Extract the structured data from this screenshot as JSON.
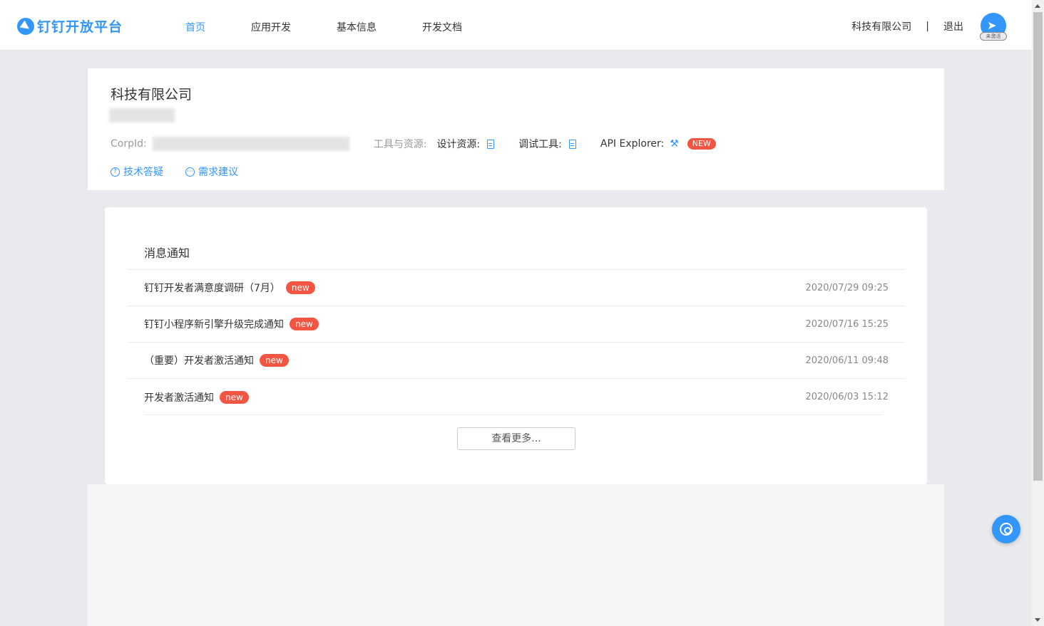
{
  "header": {
    "logo_text": "钉钉开放平台",
    "nav": [
      {
        "label": "首页",
        "active": true
      },
      {
        "label": "应用开发",
        "active": false
      },
      {
        "label": "基本信息",
        "active": false
      },
      {
        "label": "开发文档",
        "active": false
      }
    ],
    "company": "科技有限公司",
    "separator": "|",
    "logout": "退出",
    "avatar_badge": "未激活"
  },
  "company_card": {
    "name": "科技有限公司",
    "corpid_label": "CorpId:",
    "tools_label": "工具与资源:",
    "design_label": "设计资源:",
    "debug_label": "调试工具:",
    "api_label": "API Explorer:",
    "new_tag": "NEW",
    "link_qa": "技术答疑",
    "link_suggest": "需求建议"
  },
  "notifications": {
    "title": "消息通知",
    "items": [
      {
        "text": "钉钉开发者满意度调研（7月）",
        "tag": "new",
        "time": "2020/07/29 09:25"
      },
      {
        "text": "钉钉小程序新引擎升级完成通知",
        "tag": "new",
        "time": "2020/07/16 15:25"
      },
      {
        "text": "（重要）开发者激活通知",
        "tag": "new",
        "time": "2020/06/11 09:48"
      },
      {
        "text": "开发者激活通知",
        "tag": "new",
        "time": "2020/06/03 15:12"
      }
    ],
    "more_label": "查看更多..."
  },
  "colors": {
    "accent": "#3296fa",
    "tag_red": "#f25643",
    "background": "#e9eaed"
  }
}
